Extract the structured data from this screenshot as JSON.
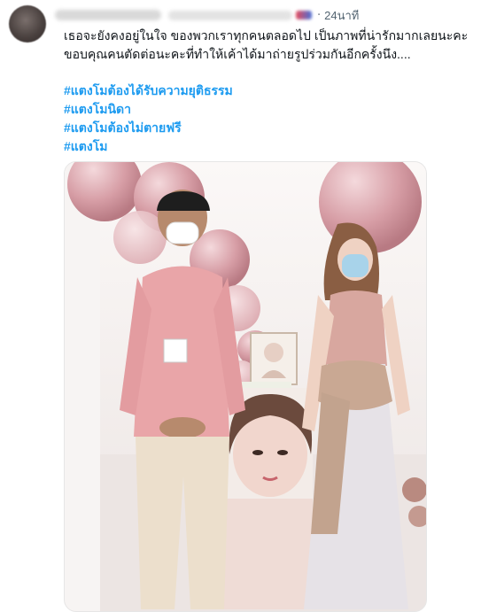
{
  "tweet": {
    "time": "24นาที",
    "dot": "·",
    "lines": [
      "เธอจะยังคงอยู่ในใจ ของพวกเราทุกคนตลอดไป เป็นภาพที่น่ารักมากเลยนะคะ",
      "ขอบคุณคนตัดต่อนะคะที่ทำให้เค้าได้มาถ่ายรูปร่วมกันอีกครั้งนึง...."
    ],
    "hashtags": [
      "#แตงโมต้องได้รับความยุติธรรม",
      "#แตงโมนิดา",
      "#แตงโมต้องไม่ตายฟรี",
      "#แตงโม"
    ]
  },
  "photo": {
    "description_colors": {
      "background": "#f4efee",
      "balloon": "#d9a6ad",
      "shirt": "#e9a5a8",
      "pants": "#e8dccb",
      "dress": "#d8b8b3"
    }
  }
}
